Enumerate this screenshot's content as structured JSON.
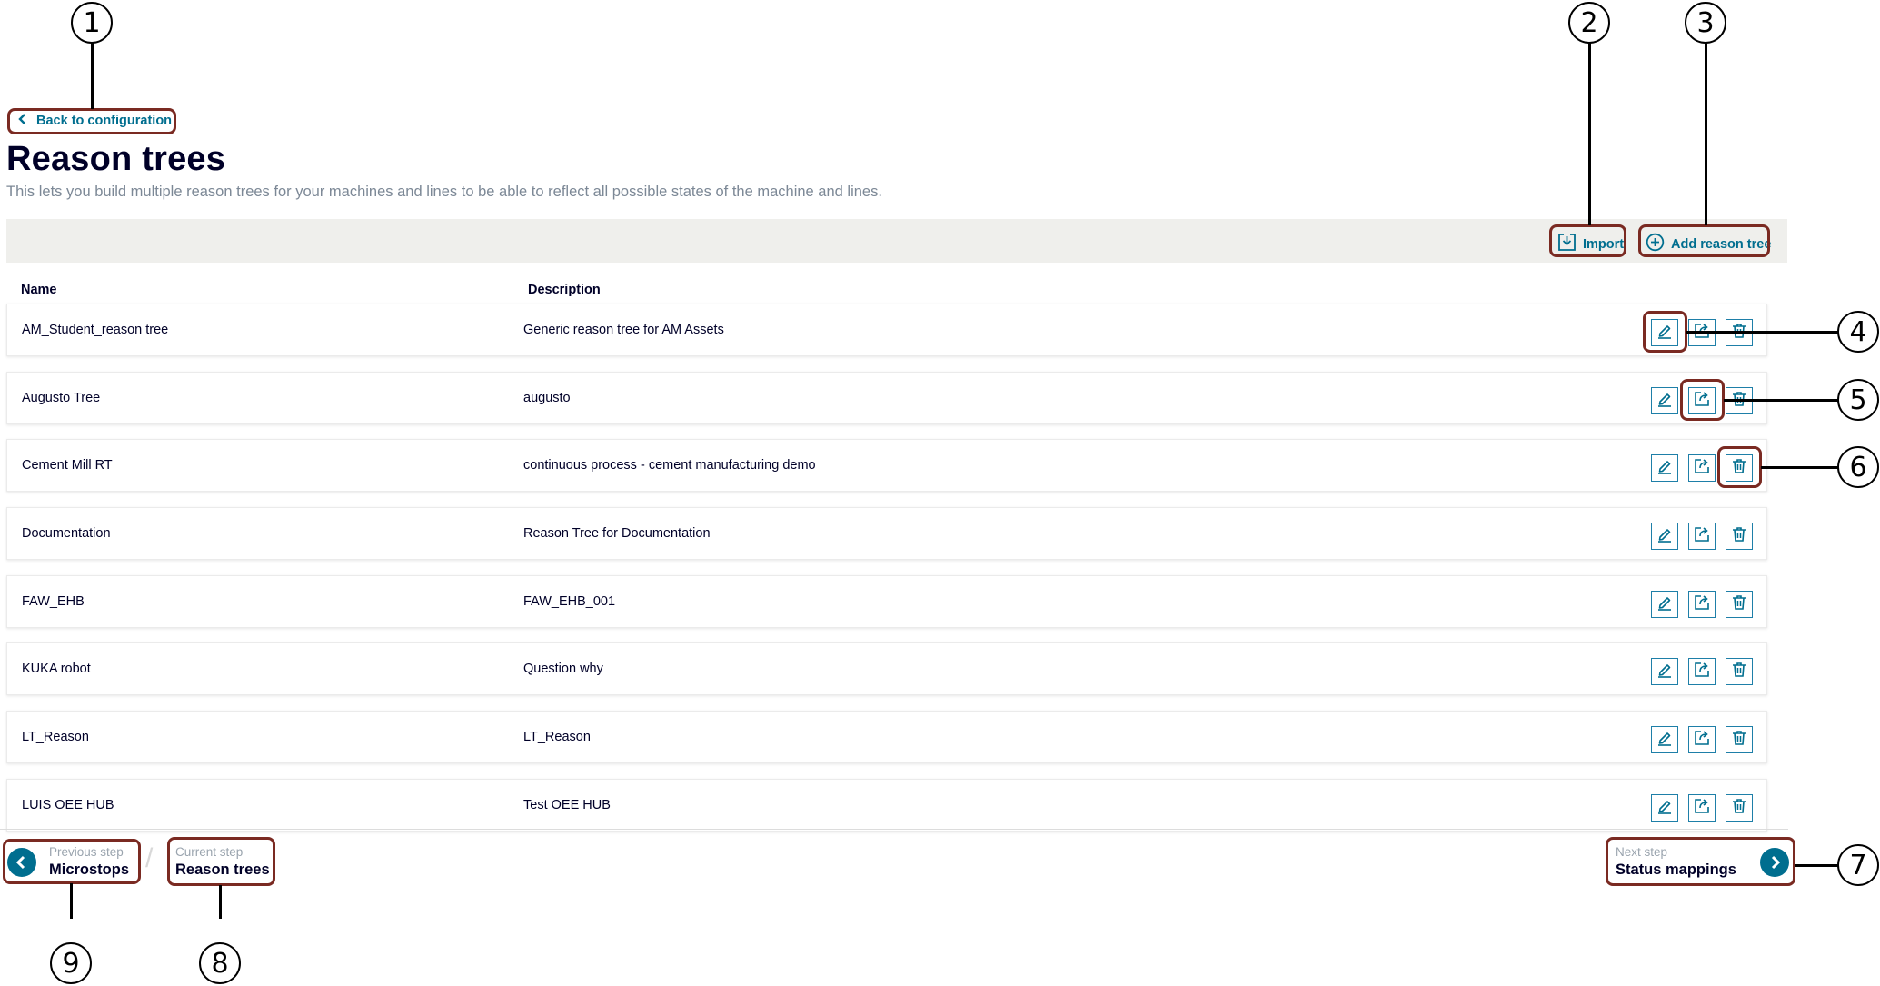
{
  "back_link": {
    "label": "Back to configuration"
  },
  "page": {
    "title": "Reason trees",
    "subtitle": "This lets you build multiple reason trees for your machines and lines to be able to reflect all possible states of the machine and lines."
  },
  "toolbar": {
    "import_label": "Import",
    "add_label": "Add reason tree"
  },
  "table": {
    "headers": {
      "name": "Name",
      "description": "Description"
    },
    "rows": [
      {
        "name": "AM_Student_reason tree",
        "description": "Generic reason tree for AM Assets"
      },
      {
        "name": "Augusto Tree",
        "description": "augusto"
      },
      {
        "name": "Cement Mill RT",
        "description": "continuous process - cement manufacturing demo"
      },
      {
        "name": "Documentation",
        "description": "Reason Tree for Documentation"
      },
      {
        "name": "FAW_EHB",
        "description": "FAW_EHB_001"
      },
      {
        "name": "KUKA robot",
        "description": "Question why"
      },
      {
        "name": "LT_Reason",
        "description": "LT_Reason"
      },
      {
        "name": "LUIS OEE HUB",
        "description": "Test OEE HUB"
      }
    ],
    "row_icons": [
      "edit-icon",
      "export-icon",
      "delete-icon"
    ]
  },
  "footer": {
    "previous": {
      "caption": "Previous step",
      "label": "Microstops"
    },
    "current": {
      "caption": "Current step",
      "label": "Reason trees"
    },
    "next": {
      "caption": "Next step",
      "label": "Status mappings"
    },
    "separator": "/"
  },
  "callouts": [
    "1",
    "2",
    "3",
    "4",
    "5",
    "6",
    "7",
    "8",
    "9"
  ],
  "colors": {
    "accent": "#006e8f",
    "callout_border": "#7a2a22",
    "toolbar_bg": "#efefec",
    "text": "#000028"
  }
}
